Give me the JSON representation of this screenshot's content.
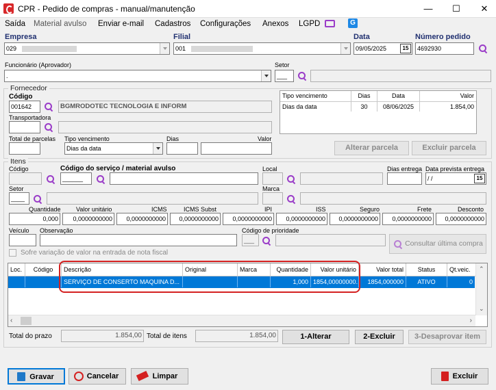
{
  "window": {
    "title": "CPR - Pedido de compras - manual/manutenção",
    "minimize": "—",
    "maximize": "☐",
    "close": "✕"
  },
  "menu": [
    "Saída",
    "Material avulso",
    "Enviar e-mail",
    "Cadastros",
    "Configurações",
    "Anexos",
    "LGPD"
  ],
  "header": {
    "empresa_label": "Empresa",
    "empresa_value": "029",
    "filial_label": "Filial",
    "filial_value": "001",
    "data_label": "Data",
    "data_value": "09/05/2025",
    "numero_label": "Número pedido",
    "numero_value": "4692930",
    "funcionario_label": "Funcionário (Aprovador)",
    "funcionario_value": ".",
    "setor_label": "Setor"
  },
  "fornecedor": {
    "group_label": "Fornecedor",
    "codigo_label": "Código",
    "codigo_value": "001642",
    "nome_value": "BGMRODOTEC TECNOLOGIA E INFORM",
    "transportadora_label": "Transportadora",
    "total_parcelas_label": "Total de parcelas",
    "tipo_venc_label": "Tipo vencimento",
    "tipo_venc_value": "Dias da data",
    "dias_label": "Dias",
    "valor_label": "Valor",
    "parcelas_headers": [
      "Tipo vencimento",
      "Dias",
      "Data",
      "Valor"
    ],
    "parcelas_row": [
      "Dias da data",
      "30",
      "08/06/2025",
      "1.854,00"
    ],
    "alterar_parcela": "Alterar parcela",
    "excluir_parcela": "Excluir parcela"
  },
  "itens": {
    "group_label": "Itens",
    "codigo_label": "Código",
    "codigo_servico_label": "Código do serviço / material avulso",
    "local_label": "Local",
    "dias_entrega_label": "Dias entrega",
    "data_prevista_label": "Data prevista entrega",
    "data_prevista_value": " / /",
    "setor_label": "Setor",
    "marca_label": "Marca",
    "value_labels": [
      "Quantidade",
      "Valor unitário",
      "ICMS",
      "ICMS Subst",
      "IPI",
      "ISS",
      "Seguro",
      "Frete",
      "Desconto"
    ],
    "value_values": [
      "0,000",
      "0,0000000000",
      "0,0000000000",
      "0,0000000000",
      "0,0000000000",
      "0,0000000000",
      "0,0000000000",
      "0,0000000000",
      "0,0000000000"
    ],
    "veiculo_label": "Veículo",
    "observacao_label": "Observação",
    "prioridade_label": "Código de prioridade",
    "consultar_label": "Consultar última compra",
    "sofre_variacao_label": "Sofre variação de valor na entrada de nota fiscal"
  },
  "grid": {
    "headers": [
      "Loc.",
      "Código",
      "Descrição",
      "Original",
      "Marca",
      "Quantidade",
      "Valor unitário",
      "Valor total",
      "Status",
      "Qt.veic."
    ],
    "row": [
      "",
      "",
      "SERVIÇO DE CONSERTO MAQUINA D...",
      "",
      "",
      "1,000",
      "1854,00000000...",
      "1854,000000",
      "ATIVO",
      "0"
    ]
  },
  "totals": {
    "total_prazo_label": "Total do prazo",
    "total_prazo_value": "1.854,00",
    "total_itens_label": "Total de itens",
    "total_itens_value": "1.854,00"
  },
  "item_buttons": {
    "alterar": "1-Alterar",
    "excluir": "2-Excluir",
    "desaprovar": "3-Desaprovar item"
  },
  "footer": {
    "gravar": "Gravar",
    "cancelar": "Cancelar",
    "limpar": "Limpar",
    "excluir": "Excluir"
  },
  "colors": {
    "selection": "#0078d7",
    "highlight_annotation": "#d42020",
    "accent_label": "#203070"
  }
}
